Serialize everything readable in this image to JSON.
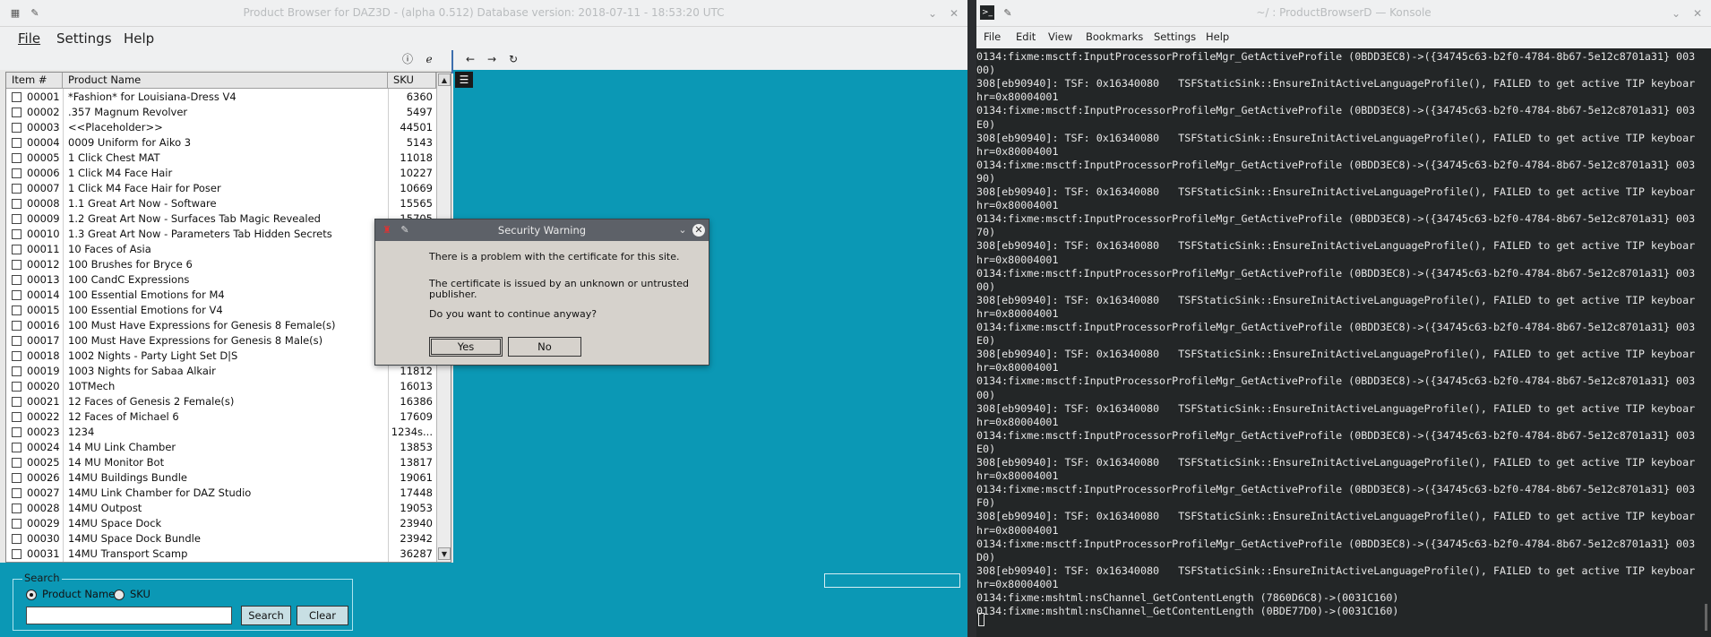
{
  "left_window": {
    "title": "Product Browser for DAZ3D - (alpha 0.512) Database version: 2018-07-11 - 18:53:20 UTC",
    "menu": [
      "File",
      "Settings",
      "Help"
    ],
    "table": {
      "headers": [
        "Item #",
        "Product Name",
        "SKU"
      ],
      "rows": [
        {
          "id": "00001",
          "name": "*Fashion* for Louisiana-Dress V4",
          "sku": "6360"
        },
        {
          "id": "00002",
          "name": ".357 Magnum Revolver",
          "sku": "5497"
        },
        {
          "id": "00003",
          "name": "<<Placeholder>>",
          "sku": "44501"
        },
        {
          "id": "00004",
          "name": "0009 Uniform for Aiko 3",
          "sku": "5143"
        },
        {
          "id": "00005",
          "name": "1 Click Chest MAT",
          "sku": "11018"
        },
        {
          "id": "00006",
          "name": "1 Click M4 Face Hair",
          "sku": "10227"
        },
        {
          "id": "00007",
          "name": "1 Click M4 Face Hair for Poser",
          "sku": "10669"
        },
        {
          "id": "00008",
          "name": "1.1 Great Art Now - Software",
          "sku": "15565"
        },
        {
          "id": "00009",
          "name": "1.2 Great Art Now - Surfaces Tab Magic Revealed",
          "sku": "15705"
        },
        {
          "id": "00010",
          "name": "1.3 Great Art Now - Parameters Tab Hidden Secrets",
          "sku": ""
        },
        {
          "id": "00011",
          "name": "10 Faces of Asia",
          "sku": ""
        },
        {
          "id": "00012",
          "name": "100 Brushes for Bryce 6",
          "sku": ""
        },
        {
          "id": "00013",
          "name": "100 CandC Expressions",
          "sku": ""
        },
        {
          "id": "00014",
          "name": "100 Essential Emotions for M4",
          "sku": ""
        },
        {
          "id": "00015",
          "name": "100 Essential Emotions for V4",
          "sku": ""
        },
        {
          "id": "00016",
          "name": "100 Must Have Expressions for Genesis 8 Female(s)",
          "sku": ""
        },
        {
          "id": "00017",
          "name": "100 Must Have Expressions for Genesis 8 Male(s)",
          "sku": ""
        },
        {
          "id": "00018",
          "name": "1002 Nights - Party Light Set D|S",
          "sku": ""
        },
        {
          "id": "00019",
          "name": "1003 Nights for Sabaa Alkair",
          "sku": "11812"
        },
        {
          "id": "00020",
          "name": "10TMech",
          "sku": "16013"
        },
        {
          "id": "00021",
          "name": "12 Faces of Genesis 2 Female(s)",
          "sku": "16386"
        },
        {
          "id": "00022",
          "name": "12 Faces of Michael 6",
          "sku": "17609"
        },
        {
          "id": "00023",
          "name": "1234",
          "sku": "1234s..."
        },
        {
          "id": "00024",
          "name": "14 MU Link Chamber",
          "sku": "13853"
        },
        {
          "id": "00025",
          "name": "14 MU Monitor Bot",
          "sku": "13817"
        },
        {
          "id": "00026",
          "name": "14MU Buildings Bundle",
          "sku": "19061"
        },
        {
          "id": "00027",
          "name": "14MU Link Chamber for DAZ Studio",
          "sku": "17448"
        },
        {
          "id": "00028",
          "name": "14MU Outpost",
          "sku": "19053"
        },
        {
          "id": "00029",
          "name": "14MU Space Dock",
          "sku": "23940"
        },
        {
          "id": "00030",
          "name": "14MU Space Dock Bundle",
          "sku": "23942"
        },
        {
          "id": "00031",
          "name": "14MU Transport Scamp",
          "sku": "36287"
        }
      ]
    },
    "search": {
      "legend": "Search",
      "option_name": "Product Name",
      "option_sku": "SKU",
      "selected": "Product Name",
      "input_value": "",
      "search_label": "Search",
      "clear_label": "Clear"
    },
    "dialog": {
      "title": "Security Warning",
      "line1": "There is a problem with the certificate for this site.",
      "line2": "The certificate is issued by an unknown or untrusted publisher.",
      "line3": "Do you want to continue anyway?",
      "yes_label": "Yes",
      "no_label": "No"
    }
  },
  "right_window": {
    "title": "~/ : ProductBrowserD — Konsole",
    "menu": [
      "File",
      "Edit",
      "View",
      "Bookmarks",
      "Settings",
      "Help"
    ],
    "terminal_lines": [
      "0134:fixme:msctf:InputProcessorProfileMgr_GetActiveProfile (0BDD3EC8)->({34745c63-b2f0-4784-8b67-5e12c8701a31} 003",
      "00)",
      "308[eb90940]: TSF: 0x16340080   TSFStaticSink::EnsureInitActiveLanguageProfile(), FAILED to get active TIP keyboar",
      "hr=0x80004001",
      "0134:fixme:msctf:InputProcessorProfileMgr_GetActiveProfile (0BDD3EC8)->({34745c63-b2f0-4784-8b67-5e12c8701a31} 003",
      "E0)",
      "308[eb90940]: TSF: 0x16340080   TSFStaticSink::EnsureInitActiveLanguageProfile(), FAILED to get active TIP keyboar",
      "hr=0x80004001",
      "0134:fixme:msctf:InputProcessorProfileMgr_GetActiveProfile (0BDD3EC8)->({34745c63-b2f0-4784-8b67-5e12c8701a31} 003",
      "90)",
      "308[eb90940]: TSF: 0x16340080   TSFStaticSink::EnsureInitActiveLanguageProfile(), FAILED to get active TIP keyboar",
      "hr=0x80004001",
      "0134:fixme:msctf:InputProcessorProfileMgr_GetActiveProfile (0BDD3EC8)->({34745c63-b2f0-4784-8b67-5e12c8701a31} 003",
      "70)",
      "308[eb90940]: TSF: 0x16340080   TSFStaticSink::EnsureInitActiveLanguageProfile(), FAILED to get active TIP keyboar",
      "hr=0x80004001",
      "0134:fixme:msctf:InputProcessorProfileMgr_GetActiveProfile (0BDD3EC8)->({34745c63-b2f0-4784-8b67-5e12c8701a31} 003",
      "00)",
      "308[eb90940]: TSF: 0x16340080   TSFStaticSink::EnsureInitActiveLanguageProfile(), FAILED to get active TIP keyboar",
      "hr=0x80004001",
      "0134:fixme:msctf:InputProcessorProfileMgr_GetActiveProfile (0BDD3EC8)->({34745c63-b2f0-4784-8b67-5e12c8701a31} 003",
      "E0)",
      "308[eb90940]: TSF: 0x16340080   TSFStaticSink::EnsureInitActiveLanguageProfile(), FAILED to get active TIP keyboar",
      "hr=0x80004001",
      "0134:fixme:msctf:InputProcessorProfileMgr_GetActiveProfile (0BDD3EC8)->({34745c63-b2f0-4784-8b67-5e12c8701a31} 003",
      "00)",
      "308[eb90940]: TSF: 0x16340080   TSFStaticSink::EnsureInitActiveLanguageProfile(), FAILED to get active TIP keyboar",
      "hr=0x80004001",
      "0134:fixme:msctf:InputProcessorProfileMgr_GetActiveProfile (0BDD3EC8)->({34745c63-b2f0-4784-8b67-5e12c8701a31} 003",
      "E0)",
      "308[eb90940]: TSF: 0x16340080   TSFStaticSink::EnsureInitActiveLanguageProfile(), FAILED to get active TIP keyboar",
      "hr=0x80004001",
      "0134:fixme:msctf:InputProcessorProfileMgr_GetActiveProfile (0BDD3EC8)->({34745c63-b2f0-4784-8b67-5e12c8701a31} 003",
      "F0)",
      "308[eb90940]: TSF: 0x16340080   TSFStaticSink::EnsureInitActiveLanguageProfile(), FAILED to get active TIP keyboar",
      "hr=0x80004001",
      "0134:fixme:msctf:InputProcessorProfileMgr_GetActiveProfile (0BDD3EC8)->({34745c63-b2f0-4784-8b67-5e12c8701a31} 003",
      "D0)",
      "308[eb90940]: TSF: 0x16340080   TSFStaticSink::EnsureInitActiveLanguageProfile(), FAILED to get active TIP keyboar",
      "hr=0x80004001",
      "0134:fixme:mshtml:nsChannel_GetContentLength (7860D6C8)->(0031C160)",
      "0134:fixme:mshtml:nsChannel_GetContentLength (0BDE77D0)->(0031C160)"
    ]
  }
}
